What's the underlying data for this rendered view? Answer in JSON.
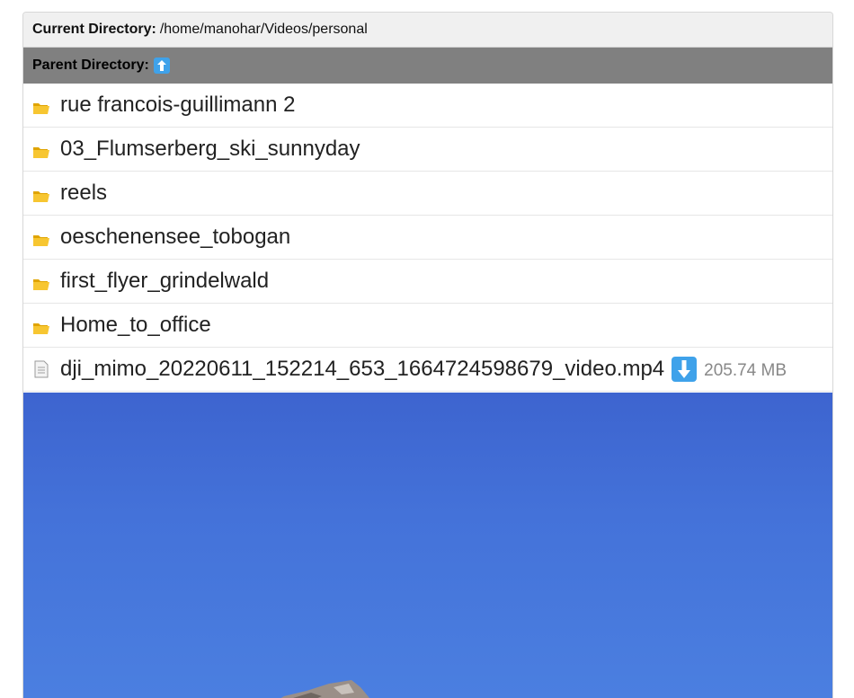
{
  "header": {
    "current_label": "Current Directory:",
    "current_path": "/home/manohar/Videos/personal",
    "parent_label": "Parent Directory:"
  },
  "entries": [
    {
      "type": "folder",
      "name": "rue francois-guillimann 2"
    },
    {
      "type": "folder",
      "name": "03_Flumserberg_ski_sunnyday"
    },
    {
      "type": "folder",
      "name": "reels"
    },
    {
      "type": "folder",
      "name": "oeschenensee_tobogan"
    },
    {
      "type": "folder",
      "name": "first_flyer_grindelwald"
    },
    {
      "type": "folder",
      "name": "Home_to_office"
    }
  ],
  "file": {
    "name": "dji_mimo_20220611_152214_653_1664724598679_video.mp4",
    "size": "205.74 MB"
  },
  "icons": {
    "folder": "open-folder-icon",
    "file": "document-icon",
    "parent": "up-arrow-icon",
    "download": "down-arrow-icon"
  },
  "colors": {
    "parent_bar": "#808080",
    "accent": "#3fa2ea",
    "preview_sky": "#4472d9"
  }
}
